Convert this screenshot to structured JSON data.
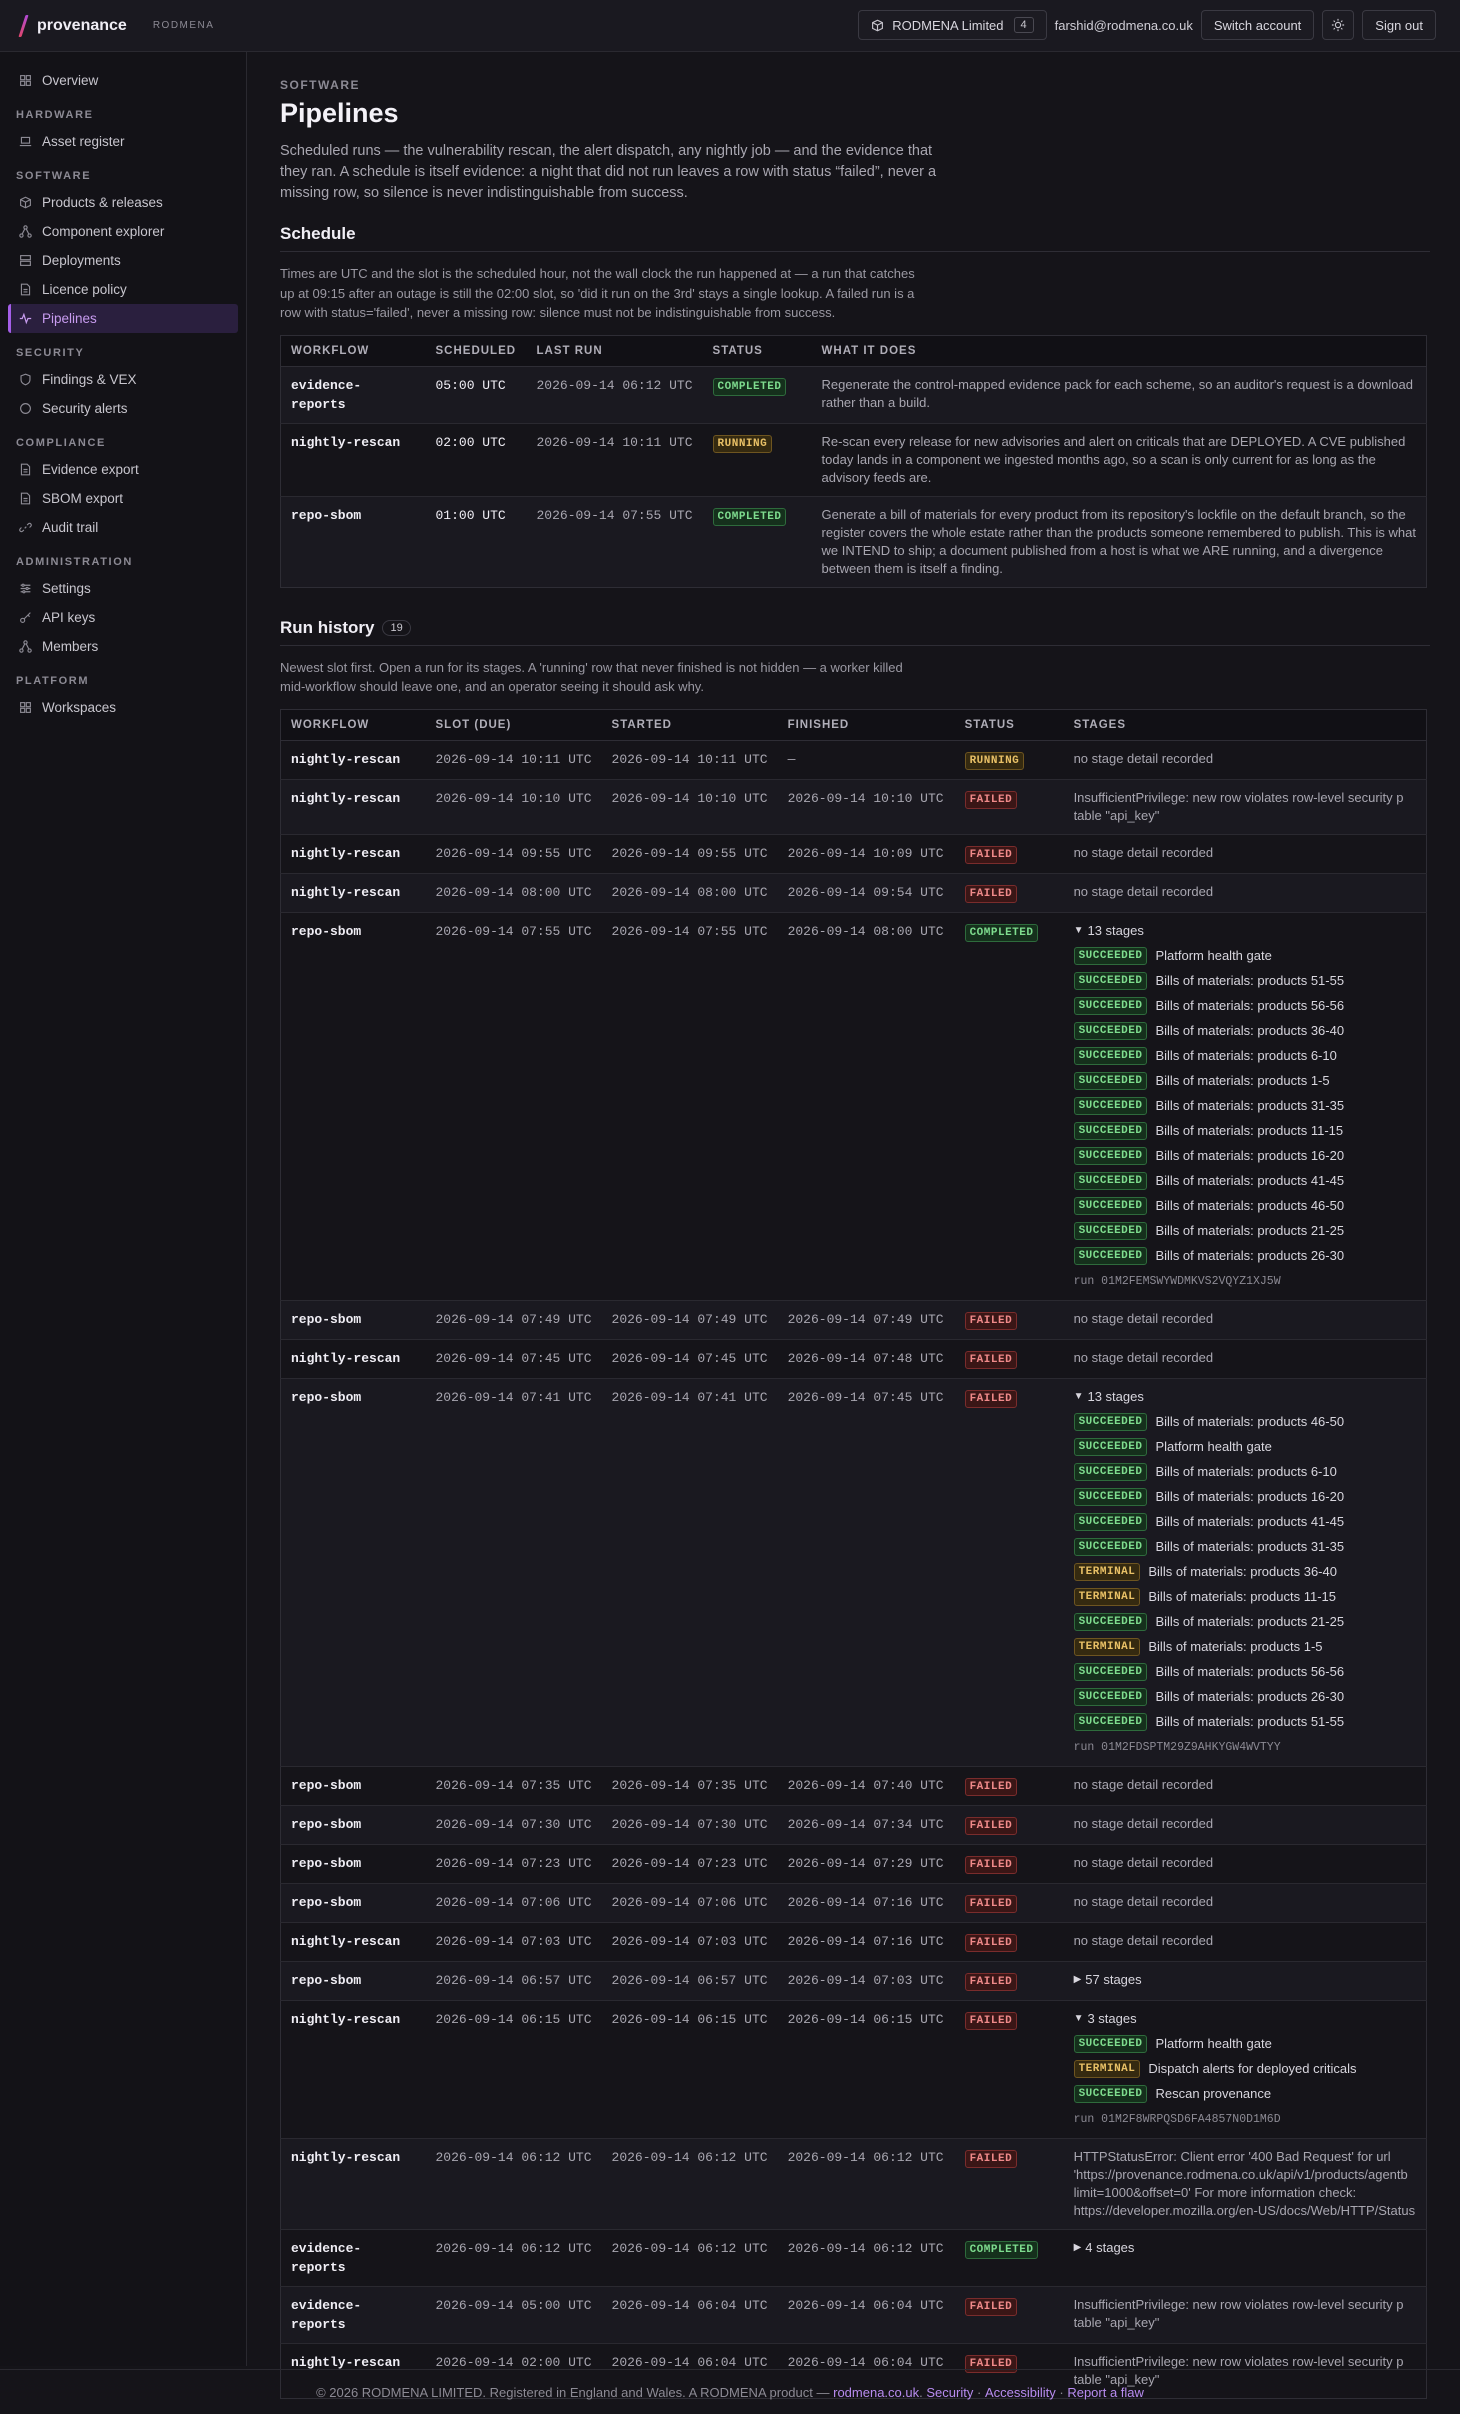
{
  "topbar": {
    "brand": "provenance",
    "org": "RODMENA",
    "workspace": "RODMENA Limited",
    "workspace_count": "4",
    "email": "farshid@rodmena.co.uk",
    "switch": "Switch account",
    "signout": "Sign out"
  },
  "sidebar": {
    "overview": "Overview",
    "hardware": "HARDWARE",
    "asset_register": "Asset register",
    "software": "SOFTWARE",
    "products": "Products & releases",
    "component_explorer": "Component explorer",
    "deployments": "Deployments",
    "licence_policy": "Licence policy",
    "pipelines": "Pipelines",
    "security": "SECURITY",
    "findings": "Findings & VEX",
    "security_alerts": "Security alerts",
    "compliance": "COMPLIANCE",
    "evidence_export": "Evidence export",
    "sbom_export": "SBOM export",
    "audit_trail": "Audit trail",
    "administration": "ADMINISTRATION",
    "settings": "Settings",
    "api_keys": "API keys",
    "members": "Members",
    "platform": "PLATFORM",
    "workspaces": "Workspaces"
  },
  "page": {
    "eyebrow": "SOFTWARE",
    "title": "Pipelines",
    "lede": "Scheduled runs — the vulnerability rescan, the alert dispatch, any nightly job — and the evidence that they ran. A schedule is itself evidence: a night that did not run leaves a row with status “failed”, never a missing row, so silence is never indistinguishable from success."
  },
  "schedule": {
    "title": "Schedule",
    "note": "Times are UTC and the slot is the scheduled hour, not the wall clock the run happened at — a run that catches up at 09:15 after an outage is still the 02:00 slot, so 'did it run on the 3rd' stays a single lookup. A failed run is a row with status='failed', never a missing row: silence must not be indistinguishable from success.",
    "headers": [
      "WORKFLOW",
      "SCHEDULED",
      "LAST RUN",
      "STATUS",
      "WHAT IT DOES"
    ],
    "rows": [
      {
        "wf": "evidence-reports",
        "sched": "05:00 UTC",
        "last": "2026-09-14 06:12 UTC",
        "status": "COMPLETED",
        "desc": "Regenerate the control-mapped evidence pack for each scheme, so an auditor's request is a download rather than a build."
      },
      {
        "wf": "nightly-rescan",
        "sched": "02:00 UTC",
        "last": "2026-09-14 10:11 UTC",
        "status": "RUNNING",
        "desc": "Re-scan every release for new advisories and alert on criticals that are DEPLOYED. A CVE published today lands in a component we ingested months ago, so a scan is only current for as long as the advisory feeds are."
      },
      {
        "wf": "repo-sbom",
        "sched": "01:00 UTC",
        "last": "2026-09-14 07:55 UTC",
        "status": "COMPLETED",
        "desc": "Generate a bill of materials for every product from its repository's lockfile on the default branch, so the register covers the whole estate rather than the products someone remembered to publish. This is what we INTEND to ship; a document published from a host is what we ARE running, and a divergence between them is itself a finding."
      }
    ]
  },
  "history": {
    "title": "Run history",
    "count": "19",
    "note": "Newest slot first. Open a run for its stages. A 'running' row that never finished is not hidden — a worker killed mid-workflow should leave one, and an operator seeing it should ask why.",
    "headers": [
      "WORKFLOW",
      "SLOT (DUE)",
      "STARTED",
      "FINISHED",
      "STATUS",
      "STAGES"
    ],
    "rows": [
      {
        "wf": "nightly-rescan",
        "slot": "2026-09-14 10:11 UTC",
        "started": "2026-09-14 10:11 UTC",
        "finished": "—",
        "status": "RUNNING",
        "text": "no stage detail recorded"
      },
      {
        "wf": "nightly-rescan",
        "slot": "2026-09-14 10:10 UTC",
        "started": "2026-09-14 10:10 UTC",
        "finished": "2026-09-14 10:10 UTC",
        "status": "FAILED",
        "text": "InsufficientPrivilege: new row violates row-level security p",
        "text2": "table \"api_key\""
      },
      {
        "wf": "nightly-rescan",
        "slot": "2026-09-14 09:55 UTC",
        "started": "2026-09-14 09:55 UTC",
        "finished": "2026-09-14 10:09 UTC",
        "status": "FAILED",
        "text": "no stage detail recorded"
      },
      {
        "wf": "nightly-rescan",
        "slot": "2026-09-14 08:00 UTC",
        "started": "2026-09-14 08:00 UTC",
        "finished": "2026-09-14 09:54 UTC",
        "status": "FAILED",
        "text": "no stage detail recorded"
      },
      {
        "wf": "repo-sbom",
        "slot": "2026-09-14 07:55 UTC",
        "started": "2026-09-14 07:55 UTC",
        "finished": "2026-09-14 08:00 UTC",
        "status": "COMPLETED",
        "summary": "13 stages",
        "open": true,
        "run_id": "run 01M2FEMSWYWDMKVS2VQYZ1XJ5W",
        "stages": [
          [
            "SUCCEEDED",
            "Platform health gate"
          ],
          [
            "SUCCEEDED",
            "Bills of materials: products 51-55"
          ],
          [
            "SUCCEEDED",
            "Bills of materials: products 56-56"
          ],
          [
            "SUCCEEDED",
            "Bills of materials: products 36-40"
          ],
          [
            "SUCCEEDED",
            "Bills of materials: products 6-10"
          ],
          [
            "SUCCEEDED",
            "Bills of materials: products 1-5"
          ],
          [
            "SUCCEEDED",
            "Bills of materials: products 31-35"
          ],
          [
            "SUCCEEDED",
            "Bills of materials: products 11-15"
          ],
          [
            "SUCCEEDED",
            "Bills of materials: products 16-20"
          ],
          [
            "SUCCEEDED",
            "Bills of materials: products 41-45"
          ],
          [
            "SUCCEEDED",
            "Bills of materials: products 46-50"
          ],
          [
            "SUCCEEDED",
            "Bills of materials: products 21-25"
          ],
          [
            "SUCCEEDED",
            "Bills of materials: products 26-30"
          ]
        ]
      },
      {
        "wf": "repo-sbom",
        "slot": "2026-09-14 07:49 UTC",
        "started": "2026-09-14 07:49 UTC",
        "finished": "2026-09-14 07:49 UTC",
        "status": "FAILED",
        "text": "no stage detail recorded"
      },
      {
        "wf": "nightly-rescan",
        "slot": "2026-09-14 07:45 UTC",
        "started": "2026-09-14 07:45 UTC",
        "finished": "2026-09-14 07:48 UTC",
        "status": "FAILED",
        "text": "no stage detail recorded"
      },
      {
        "wf": "repo-sbom",
        "slot": "2026-09-14 07:41 UTC",
        "started": "2026-09-14 07:41 UTC",
        "finished": "2026-09-14 07:45 UTC",
        "status": "FAILED",
        "summary": "13 stages",
        "open": true,
        "run_id": "run 01M2FDSPTM29Z9AHKYGW4WVTYY",
        "stages": [
          [
            "SUCCEEDED",
            "Bills of materials: products 46-50"
          ],
          [
            "SUCCEEDED",
            "Platform health gate"
          ],
          [
            "SUCCEEDED",
            "Bills of materials: products 6-10"
          ],
          [
            "SUCCEEDED",
            "Bills of materials: products 16-20"
          ],
          [
            "SUCCEEDED",
            "Bills of materials: products 41-45"
          ],
          [
            "SUCCEEDED",
            "Bills of materials: products 31-35"
          ],
          [
            "TERMINAL",
            "Bills of materials: products 36-40"
          ],
          [
            "TERMINAL",
            "Bills of materials: products 11-15"
          ],
          [
            "SUCCEEDED",
            "Bills of materials: products 21-25"
          ],
          [
            "TERMINAL",
            "Bills of materials: products 1-5"
          ],
          [
            "SUCCEEDED",
            "Bills of materials: products 56-56"
          ],
          [
            "SUCCEEDED",
            "Bills of materials: products 26-30"
          ],
          [
            "SUCCEEDED",
            "Bills of materials: products 51-55"
          ]
        ]
      },
      {
        "wf": "repo-sbom",
        "slot": "2026-09-14 07:35 UTC",
        "started": "2026-09-14 07:35 UTC",
        "finished": "2026-09-14 07:40 UTC",
        "status": "FAILED",
        "text": "no stage detail recorded"
      },
      {
        "wf": "repo-sbom",
        "slot": "2026-09-14 07:30 UTC",
        "started": "2026-09-14 07:30 UTC",
        "finished": "2026-09-14 07:34 UTC",
        "status": "FAILED",
        "text": "no stage detail recorded"
      },
      {
        "wf": "repo-sbom",
        "slot": "2026-09-14 07:23 UTC",
        "started": "2026-09-14 07:23 UTC",
        "finished": "2026-09-14 07:29 UTC",
        "status": "FAILED",
        "text": "no stage detail recorded"
      },
      {
        "wf": "repo-sbom",
        "slot": "2026-09-14 07:06 UTC",
        "started": "2026-09-14 07:06 UTC",
        "finished": "2026-09-14 07:16 UTC",
        "status": "FAILED",
        "text": "no stage detail recorded"
      },
      {
        "wf": "nightly-rescan",
        "slot": "2026-09-14 07:03 UTC",
        "started": "2026-09-14 07:03 UTC",
        "finished": "2026-09-14 07:16 UTC",
        "status": "FAILED",
        "text": "no stage detail recorded"
      },
      {
        "wf": "repo-sbom",
        "slot": "2026-09-14 06:57 UTC",
        "started": "2026-09-14 06:57 UTC",
        "finished": "2026-09-14 07:03 UTC",
        "status": "FAILED",
        "summary": "57 stages",
        "open": false
      },
      {
        "wf": "nightly-rescan",
        "slot": "2026-09-14 06:15 UTC",
        "started": "2026-09-14 06:15 UTC",
        "finished": "2026-09-14 06:15 UTC",
        "status": "FAILED",
        "summary": "3 stages",
        "open": true,
        "run_id": "run 01M2F8WRPQSD6FA4857N0D1M6D",
        "stages": [
          [
            "SUCCEEDED",
            "Platform health gate"
          ],
          [
            "TERMINAL",
            "Dispatch alerts for deployed criticals"
          ],
          [
            "SUCCEEDED",
            "Rescan provenance"
          ]
        ]
      },
      {
        "wf": "nightly-rescan",
        "slot": "2026-09-14 06:12 UTC",
        "started": "2026-09-14 06:12 UTC",
        "finished": "2026-09-14 06:12 UTC",
        "status": "FAILED",
        "text": "HTTPStatusError: Client error '400 Bad Request' for url",
        "text2": "'https://provenance.rodmena.co.uk/api/v1/products/agentb",
        "text3": "limit=1000&offset=0' For more information check:",
        "text4": "https://developer.mozilla.org/en-US/docs/Web/HTTP/Status"
      },
      {
        "wf": "evidence-reports",
        "slot": "2026-09-14 06:12 UTC",
        "started": "2026-09-14 06:12 UTC",
        "finished": "2026-09-14 06:12 UTC",
        "status": "COMPLETED",
        "summary": "4 stages",
        "open": false
      },
      {
        "wf": "evidence-reports",
        "slot": "2026-09-14 05:00 UTC",
        "started": "2026-09-14 06:04 UTC",
        "finished": "2026-09-14 06:04 UTC",
        "status": "FAILED",
        "text": "InsufficientPrivilege: new row violates row-level security p",
        "text2": "table \"api_key\""
      },
      {
        "wf": "nightly-rescan",
        "slot": "2026-09-14 02:00 UTC",
        "started": "2026-09-14 06:04 UTC",
        "finished": "2026-09-14 06:04 UTC",
        "status": "FAILED",
        "text": "InsufficientPrivilege: new row violates row-level security p",
        "text2": "table \"api_key\""
      }
    ]
  },
  "footer": {
    "text": "© 2026 RODMENA LIMITED. Registered in England and Wales. A RODMENA product —",
    "link1": "rodmena.co.uk",
    "sep1": ".",
    "link2": "Security",
    "sep2": "·",
    "link3": "Accessibility",
    "sep3": "·",
    "link4": "Report a flaw"
  }
}
